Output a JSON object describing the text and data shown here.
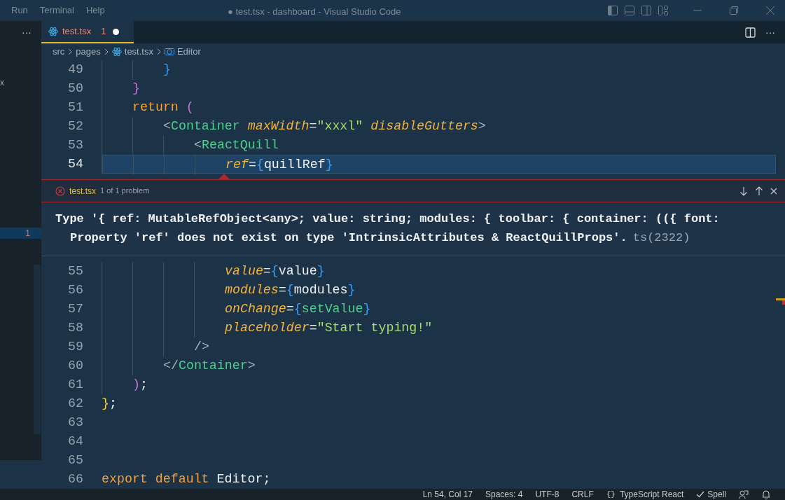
{
  "menu": [
    "Run",
    "Terminal",
    "Help"
  ],
  "window": {
    "title": "● test.tsx - dashboard - Visual Studio Code"
  },
  "sidebar": {
    "more": "···",
    "rows": [
      {
        "text": "x",
        "selected": false
      },
      {
        "text": "1",
        "selected": true
      }
    ]
  },
  "editor_more": "···",
  "tabs": [
    {
      "label": "test.tsx",
      "problems": "1",
      "dirty": true,
      "selected": true
    }
  ],
  "breadcrumb": [
    "src",
    "pages",
    "test.tsx",
    "Editor"
  ],
  "lines": [
    {
      "number": "49",
      "current": false,
      "tokens": [
        {
          "kind": "indent"
        },
        {
          "kind": "indent"
        },
        {
          "kind": "brace",
          "text": "}"
        }
      ]
    },
    {
      "number": "50",
      "current": false,
      "tokens": [
        {
          "kind": "indent"
        },
        {
          "kind": "paren",
          "text": "}"
        }
      ]
    },
    {
      "number": "51",
      "current": false,
      "tokens": [
        {
          "kind": "indent"
        },
        {
          "kind": "keyword",
          "text": "return "
        },
        {
          "kind": "paren",
          "text": "("
        }
      ]
    },
    {
      "number": "52",
      "current": false,
      "tokens": [
        {
          "kind": "indent"
        },
        {
          "kind": "indent"
        },
        {
          "kind": "punct",
          "text": "<"
        },
        {
          "kind": "tag",
          "text": "Container "
        },
        {
          "kind": "attr",
          "text": "maxWidth"
        },
        {
          "kind": "plain",
          "text": "="
        },
        {
          "kind": "string",
          "text": "\"xxxl\" "
        },
        {
          "kind": "attr",
          "text": "disableGutters"
        },
        {
          "kind": "punct",
          "text": ">"
        }
      ]
    },
    {
      "number": "53",
      "current": false,
      "tokens": [
        {
          "kind": "indent"
        },
        {
          "kind": "indent"
        },
        {
          "kind": "indent"
        },
        {
          "kind": "punct",
          "text": "<"
        },
        {
          "kind": "tag",
          "text": "ReactQuill"
        }
      ]
    },
    {
      "number": "54",
      "current": true,
      "tokens": [
        {
          "kind": "indent"
        },
        {
          "kind": "indent"
        },
        {
          "kind": "indent"
        },
        {
          "kind": "indent"
        },
        {
          "kind": "attr",
          "text": "ref"
        },
        {
          "kind": "plain",
          "text": "="
        },
        {
          "kind": "brace",
          "text": "{"
        },
        {
          "kind": "plain",
          "text": "quillRef"
        },
        {
          "kind": "brace",
          "text": "}"
        }
      ]
    }
  ],
  "problem": {
    "file": "test.tsx",
    "count": "1 of 1 problem",
    "message": "Type '{ ref: MutableRefObject<any>; value: string; modules: { toolbar: { container: (({ font:",
    "detail": "Property 'ref' does not exist on type 'IntrinsicAttributes & ReactQuillProps'.",
    "code": "ts(2322)"
  },
  "lines_after": [
    {
      "number": "55",
      "current": false,
      "tokens": [
        {
          "kind": "indent"
        },
        {
          "kind": "indent"
        },
        {
          "kind": "indent"
        },
        {
          "kind": "indent"
        },
        {
          "kind": "attr",
          "text": "value"
        },
        {
          "kind": "plain",
          "text": "="
        },
        {
          "kind": "brace",
          "text": "{"
        },
        {
          "kind": "plain",
          "text": "value"
        },
        {
          "kind": "brace",
          "text": "}"
        }
      ]
    },
    {
      "number": "56",
      "current": false,
      "tokens": [
        {
          "kind": "indent"
        },
        {
          "kind": "indent"
        },
        {
          "kind": "indent"
        },
        {
          "kind": "indent"
        },
        {
          "kind": "attr",
          "text": "modules"
        },
        {
          "kind": "plain",
          "text": "="
        },
        {
          "kind": "brace",
          "text": "{"
        },
        {
          "kind": "plain",
          "text": "modules"
        },
        {
          "kind": "brace",
          "text": "}"
        }
      ]
    },
    {
      "number": "57",
      "current": false,
      "tokens": [
        {
          "kind": "indent"
        },
        {
          "kind": "indent"
        },
        {
          "kind": "indent"
        },
        {
          "kind": "indent"
        },
        {
          "kind": "attr",
          "text": "onChange"
        },
        {
          "kind": "plain",
          "text": "="
        },
        {
          "kind": "brace",
          "text": "{"
        },
        {
          "kind": "func",
          "text": "setValue"
        },
        {
          "kind": "brace",
          "text": "}"
        }
      ]
    },
    {
      "number": "58",
      "current": false,
      "tokens": [
        {
          "kind": "indent"
        },
        {
          "kind": "indent"
        },
        {
          "kind": "indent"
        },
        {
          "kind": "indent"
        },
        {
          "kind": "attr",
          "text": "placeholder"
        },
        {
          "kind": "plain",
          "text": "="
        },
        {
          "kind": "string",
          "text": "\"Start typing!\""
        }
      ]
    },
    {
      "number": "59",
      "current": false,
      "tokens": [
        {
          "kind": "indent"
        },
        {
          "kind": "indent"
        },
        {
          "kind": "indent"
        },
        {
          "kind": "punct",
          "text": "/>"
        }
      ]
    },
    {
      "number": "60",
      "current": false,
      "tokens": [
        {
          "kind": "indent"
        },
        {
          "kind": "indent"
        },
        {
          "kind": "punct",
          "text": "</"
        },
        {
          "kind": "tag",
          "text": "Container"
        },
        {
          "kind": "punct",
          "text": ">"
        }
      ]
    },
    {
      "number": "61",
      "current": false,
      "tokens": [
        {
          "kind": "indent"
        },
        {
          "kind": "paren",
          "text": ")"
        },
        {
          "kind": "plain",
          "text": ";"
        }
      ]
    },
    {
      "number": "62",
      "current": false,
      "tokens": [
        {
          "kind": "yellow",
          "text": "}"
        },
        {
          "kind": "plain",
          "text": ";"
        }
      ]
    },
    {
      "number": "63",
      "current": false
    },
    {
      "number": "64",
      "current": false
    },
    {
      "number": "65",
      "current": false
    },
    {
      "number": "66",
      "current": false,
      "tokens": [
        {
          "kind": "keyword",
          "text": "export default "
        },
        {
          "kind": "plain",
          "text": "Editor;"
        }
      ]
    }
  ],
  "status_bar": [
    {
      "kind": "text",
      "text": "Ln 54, Col 17"
    },
    {
      "kind": "text",
      "text": "Spaces: 4"
    },
    {
      "kind": "text",
      "text": "UTF-8"
    },
    {
      "kind": "text",
      "text": "CRLF"
    },
    {
      "kind": "language",
      "icon": "{}",
      "text": "TypeScript React"
    },
    {
      "kind": "spell",
      "text": "Spell"
    },
    {
      "kind": "feedback"
    },
    {
      "kind": "bell"
    }
  ]
}
